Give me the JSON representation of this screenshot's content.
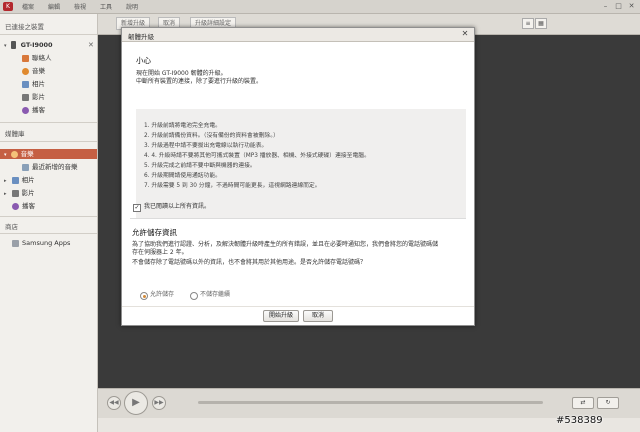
{
  "menubar": {
    "items": [
      "檔案",
      "編輯",
      "檢視",
      "工具",
      "說明"
    ]
  },
  "sidebar": {
    "connected_title": "已連接之裝置",
    "device_name": "GT-I9000",
    "device_items": [
      "聯絡人",
      "音樂",
      "相片",
      "影片",
      "播客"
    ],
    "library_title": "媒體庫",
    "library_items": [
      "音樂",
      "最近新增的音樂",
      "相片",
      "影片",
      "播客"
    ],
    "store_title": "商店",
    "store_items": [
      "Samsung Apps"
    ]
  },
  "main": {
    "tabs": [
      "新增升級",
      "取消",
      "升級詳細設定"
    ]
  },
  "dialog": {
    "title": "韌體升級",
    "notice_head": "小心",
    "notice_lines": [
      "現在開始 GT-I9000 韌體的升級。",
      "中斷所有裝置的連接，除了要進行升級的裝置。"
    ],
    "steps": [
      "1. 升級前請將電池完全充電。",
      "2. 升級前請備份資料。（沒有備份的資料會被刪除。）",
      "3. 升級過程中請不要拔出充電線以執行功能表。",
      "4. 4. 升級時請不要將其他可攜式裝置（MP3 播放器、相機、外接式硬碟）連接至電腦。",
      "5. 升級完成之前請不要中斷與機器的連接。",
      "6. 升級期間請使用通話功能。",
      "7. 升級需要 5 到 30 分鐘，不過時間可能更長，這視網路連線而定。"
    ],
    "confirm_label": "我已閱讀以上所有資訊。",
    "confirm_checked": true,
    "permission_head": "允許儲存資訊",
    "permission_lines": [
      "為了協助我們進行認證、分析，及解決韌體升級時產生的所有錯誤，並且在必要時通知您，我們會將您的電話號碼儲",
      "存在伺服器上 2 年。",
      "不會儲存除了電話號碼以外的資訊，也不會將其用於其他用途。是否允許儲存電話號碼？"
    ],
    "radio_allow": "允許儲存",
    "radio_deny": "不儲存繼續",
    "radio_selected": "allow",
    "start_button": "開始升級",
    "cancel_button": "取消"
  },
  "watermark": "#538389",
  "colors": {
    "accent_selected": "#c55f43",
    "main_bg": "#3a3a3a",
    "app_brand": "#b3282d"
  }
}
